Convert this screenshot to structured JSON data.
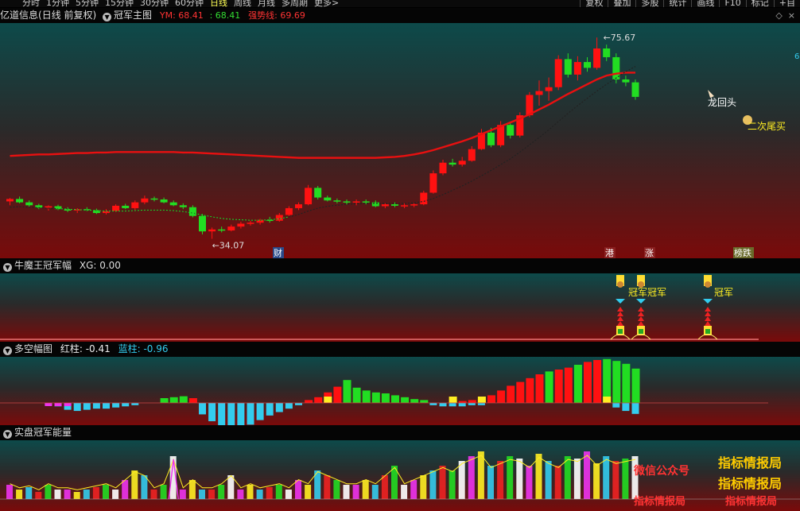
{
  "toolbar": {
    "periods": [
      "分时",
      "1分钟",
      "5分钟",
      "15分钟",
      "30分钟",
      "60分钟",
      "日线",
      "周线",
      "月线",
      "多周期",
      "更多>"
    ],
    "active_period": "日线",
    "buttons": [
      "复权",
      "叠加",
      "多股",
      "统计",
      "画线",
      "F10",
      "标记",
      "+自"
    ]
  },
  "main_panel": {
    "stock_name": "亿道信息",
    "period_info": "(日线 前复权)",
    "indicator": "冠军主图",
    "ym_label": "YM: 68.41",
    "ym2_label": ": 68.41",
    "trend_label": "强势线: 69.69",
    "high_label": "75.67",
    "low_label": "34.07",
    "annotations": [
      "龙回头",
      "二次尾买"
    ],
    "bottom_tags": [
      "财",
      "港",
      "涨",
      "榜跌"
    ],
    "right_edge": "6"
  },
  "sub1": {
    "title": "牛魔王冠军幅",
    "value": "XG: 0.00",
    "signal_labels": [
      "冠军",
      "冠军",
      "冠军"
    ]
  },
  "sub2": {
    "title": "多空幅图",
    "red_label": "红柱: -0.41",
    "blue_label": "蓝柱: -0.96"
  },
  "sub3": {
    "title": "实盘冠军能量"
  },
  "watermarks": [
    "指标情报局",
    "微信公众号",
    "指标情报局",
    "指标情报局",
    "指标情报局"
  ],
  "colors": {
    "up": "#ff1111",
    "down": "#22dd22",
    "ma": "#e81010",
    "cyan": "#33ccee",
    "yellow": "#ffee22",
    "magenta": "#ee33ee"
  },
  "chart_data": [
    {
      "type": "candlestick",
      "panel": "main",
      "note": "OHLC read from price axis estimates",
      "candles": [
        [
          41.8,
          42.5,
          41.0,
          42.3
        ],
        [
          42.3,
          42.8,
          41.4,
          41.6
        ],
        [
          41.6,
          42.0,
          40.7,
          41.0
        ],
        [
          41.0,
          41.3,
          40.2,
          40.5
        ],
        [
          40.5,
          41.0,
          39.9,
          40.8
        ],
        [
          40.8,
          41.1,
          40.0,
          40.2
        ],
        [
          40.2,
          40.6,
          39.6,
          39.9
        ],
        [
          39.9,
          40.4,
          39.4,
          40.2
        ],
        [
          40.2,
          40.6,
          39.8,
          40.0
        ],
        [
          40.0,
          40.3,
          39.2,
          39.4
        ],
        [
          39.4,
          40.2,
          39.1,
          39.8
        ],
        [
          39.8,
          41.2,
          39.6,
          40.9
        ],
        [
          40.9,
          41.3,
          40.2,
          40.4
        ],
        [
          40.4,
          42.0,
          40.0,
          41.6
        ],
        [
          41.6,
          43.0,
          41.2,
          42.4
        ],
        [
          42.4,
          42.8,
          41.8,
          42.2
        ],
        [
          42.2,
          42.6,
          41.4,
          41.6
        ],
        [
          41.6,
          42.0,
          40.8,
          41.0
        ],
        [
          41.0,
          41.4,
          40.2,
          40.6
        ],
        [
          40.6,
          41.0,
          38.5,
          38.8
        ],
        [
          38.8,
          39.2,
          35.0,
          35.6
        ],
        [
          35.6,
          36.4,
          34.07,
          36.0
        ],
        [
          36.0,
          36.6,
          35.4,
          35.8
        ],
        [
          35.8,
          37.0,
          35.6,
          36.6
        ],
        [
          36.6,
          37.6,
          36.2,
          37.2
        ],
        [
          37.2,
          37.8,
          36.8,
          37.4
        ],
        [
          37.4,
          38.2,
          37.0,
          38.0
        ],
        [
          38.0,
          38.6,
          37.4,
          37.8
        ],
        [
          37.8,
          39.4,
          37.6,
          39.0
        ],
        [
          39.0,
          40.8,
          38.8,
          40.4
        ],
        [
          40.4,
          41.6,
          40.0,
          41.2
        ],
        [
          41.2,
          45.2,
          41.0,
          44.6
        ],
        [
          44.6,
          45.0,
          42.2,
          42.6
        ],
        [
          42.6,
          43.0,
          41.8,
          42.0
        ],
        [
          42.0,
          42.4,
          41.4,
          41.8
        ],
        [
          41.8,
          42.2,
          41.2,
          41.6
        ],
        [
          41.6,
          42.2,
          41.0,
          41.8
        ],
        [
          41.8,
          42.2,
          41.2,
          41.6
        ],
        [
          41.6,
          42.0,
          40.6,
          40.8
        ],
        [
          40.8,
          41.4,
          40.4,
          41.2
        ],
        [
          41.2,
          41.6,
          40.6,
          40.9
        ],
        [
          40.9,
          41.4,
          40.4,
          41.0
        ],
        [
          41.0,
          41.4,
          40.6,
          41.2
        ],
        [
          41.2,
          44.0,
          41.0,
          43.6
        ],
        [
          43.6,
          48.2,
          43.4,
          47.6
        ],
        [
          47.6,
          50.4,
          47.2,
          49.8
        ],
        [
          49.8,
          50.6,
          49.0,
          49.4
        ],
        [
          49.4,
          51.0,
          49.0,
          50.2
        ],
        [
          50.2,
          53.2,
          50.0,
          52.6
        ],
        [
          52.6,
          56.8,
          52.4,
          56.0
        ],
        [
          56.0,
          57.0,
          53.0,
          53.4
        ],
        [
          53.4,
          58.4,
          53.0,
          57.6
        ],
        [
          57.6,
          58.0,
          54.8,
          55.4
        ],
        [
          55.4,
          60.2,
          55.0,
          59.6
        ],
        [
          59.6,
          64.4,
          59.2,
          63.8
        ],
        [
          63.8,
          66.8,
          61.6,
          64.6
        ],
        [
          64.6,
          67.4,
          62.6,
          65.4
        ],
        [
          65.4,
          72.0,
          64.8,
          71.2
        ],
        [
          71.2,
          72.4,
          67.4,
          68.0
        ],
        [
          68.0,
          71.8,
          66.8,
          70.6
        ],
        [
          70.6,
          71.6,
          68.6,
          69.4
        ],
        [
          69.4,
          75.67,
          69.0,
          73.4
        ],
        [
          73.4,
          74.2,
          70.8,
          71.6
        ],
        [
          71.6,
          72.4,
          66.2,
          67.0
        ],
        [
          67.0,
          67.8,
          65.6,
          66.4
        ],
        [
          66.4,
          67.0,
          62.8,
          63.4
        ]
      ],
      "series": [
        {
          "name": "YM",
          "values": [
            51.2,
            51.3,
            51.4,
            51.5,
            51.5,
            51.6,
            51.7,
            51.8,
            51.8,
            51.9,
            51.9,
            52.0,
            52.0,
            52.0,
            52.0,
            52.0,
            52.0,
            52.0,
            51.9,
            51.9,
            51.8,
            51.7,
            51.6,
            51.5,
            51.4,
            51.3,
            51.2,
            51.1,
            51.0,
            50.9,
            50.8,
            50.8,
            50.8,
            50.8,
            50.8,
            50.8,
            50.8,
            50.8,
            50.8,
            50.9,
            51.0,
            51.2,
            51.5,
            51.9,
            52.4,
            53.0,
            53.6,
            54.2,
            54.9,
            55.7,
            56.5,
            57.3,
            58.1,
            58.9,
            59.8,
            60.8,
            61.8,
            62.9,
            64.0,
            65.0,
            66.0,
            67.0,
            67.8,
            68.2,
            68.4,
            68.41
          ]
        },
        {
          "name": "强势线",
          "values": [
            40.6,
            40.7,
            40.6,
            40.5,
            40.4,
            40.3,
            40.2,
            40.1,
            40.0,
            39.9,
            39.8,
            39.8,
            39.8,
            39.9,
            40.0,
            40.0,
            40.0,
            39.9,
            39.7,
            39.4,
            39.0,
            38.6,
            38.3,
            38.1,
            38.0,
            37.9,
            37.9,
            38.0,
            38.2,
            38.6,
            39.1,
            39.8,
            40.4,
            40.8,
            41.0,
            41.2,
            41.3,
            41.4,
            41.4,
            41.4,
            41.4,
            41.4,
            41.5,
            41.8,
            42.4,
            43.2,
            44.1,
            45.0,
            46.0,
            47.1,
            48.2,
            49.4,
            50.6,
            52.0,
            53.5,
            55.0,
            56.6,
            58.3,
            60.0,
            61.6,
            63.1,
            64.6,
            66.0,
            67.3,
            68.6,
            69.69
          ]
        }
      ],
      "ylim": [
        33,
        78
      ]
    },
    {
      "type": "bar",
      "panel": "多空幅图",
      "red_values": [
        0,
        0,
        0,
        0,
        0,
        0,
        0,
        0,
        0,
        0,
        0,
        0,
        0,
        0,
        0,
        0,
        0.5,
        0.6,
        0.7,
        0.5,
        0,
        0,
        0,
        0,
        0,
        0,
        0,
        0,
        0,
        0,
        0,
        0.3,
        0.6,
        1.1,
        1.7,
        2.4,
        1.6,
        1.3,
        1.1,
        1.0,
        0.8,
        0.6,
        0.4,
        0.3,
        0,
        0,
        0.1,
        0.2,
        0.3,
        0.4,
        0.8,
        1.3,
        1.8,
        2.2,
        2.6,
        3.0,
        3.3,
        3.5,
        3.7,
        4.0,
        4.3,
        4.5,
        4.6,
        4.4,
        4.1,
        3.6
      ],
      "cyan_values": [
        0,
        0,
        0,
        0,
        -0.2,
        -0.3,
        -0.6,
        -0.7,
        -0.6,
        -0.5,
        -0.5,
        -0.4,
        -0.3,
        -0.2,
        0,
        0,
        0,
        0,
        0,
        0,
        -1.0,
        -1.6,
        -2.2,
        -2.5,
        -2.3,
        -1.9,
        -1.5,
        -1.1,
        -0.8,
        -0.5,
        -0.2,
        0,
        0,
        0,
        0,
        0,
        0,
        0,
        0,
        0,
        0,
        0,
        0,
        0,
        -0.2,
        -0.3,
        -0.3,
        -0.3,
        -0.2,
        -0.2,
        0,
        0,
        0,
        0,
        0,
        0,
        0,
        0,
        0,
        0,
        0,
        0,
        0,
        -0.4,
        -0.7,
        -0.96
      ]
    },
    {
      "type": "bar",
      "panel": "实盘冠军能量",
      "values": [
        0.3,
        0.2,
        0.25,
        0.15,
        0.3,
        0.2,
        0.2,
        0.15,
        0.2,
        0.25,
        0.3,
        0.2,
        0.4,
        0.6,
        0.5,
        0.2,
        0.3,
        0.9,
        0.2,
        0.4,
        0.2,
        0.2,
        0.3,
        0.5,
        0.2,
        0.3,
        0.2,
        0.25,
        0.3,
        0.2,
        0.4,
        0.3,
        0.6,
        0.5,
        0.4,
        0.3,
        0.3,
        0.4,
        0.3,
        0.5,
        0.7,
        0.3,
        0.4,
        0.5,
        0.6,
        0.7,
        0.6,
        0.8,
        0.9,
        1.0,
        0.7,
        0.8,
        0.9,
        0.85,
        0.7,
        0.95,
        0.8,
        0.7,
        0.9,
        0.85,
        1.0,
        0.75,
        0.9,
        0.8,
        0.85,
        0.9
      ]
    }
  ]
}
